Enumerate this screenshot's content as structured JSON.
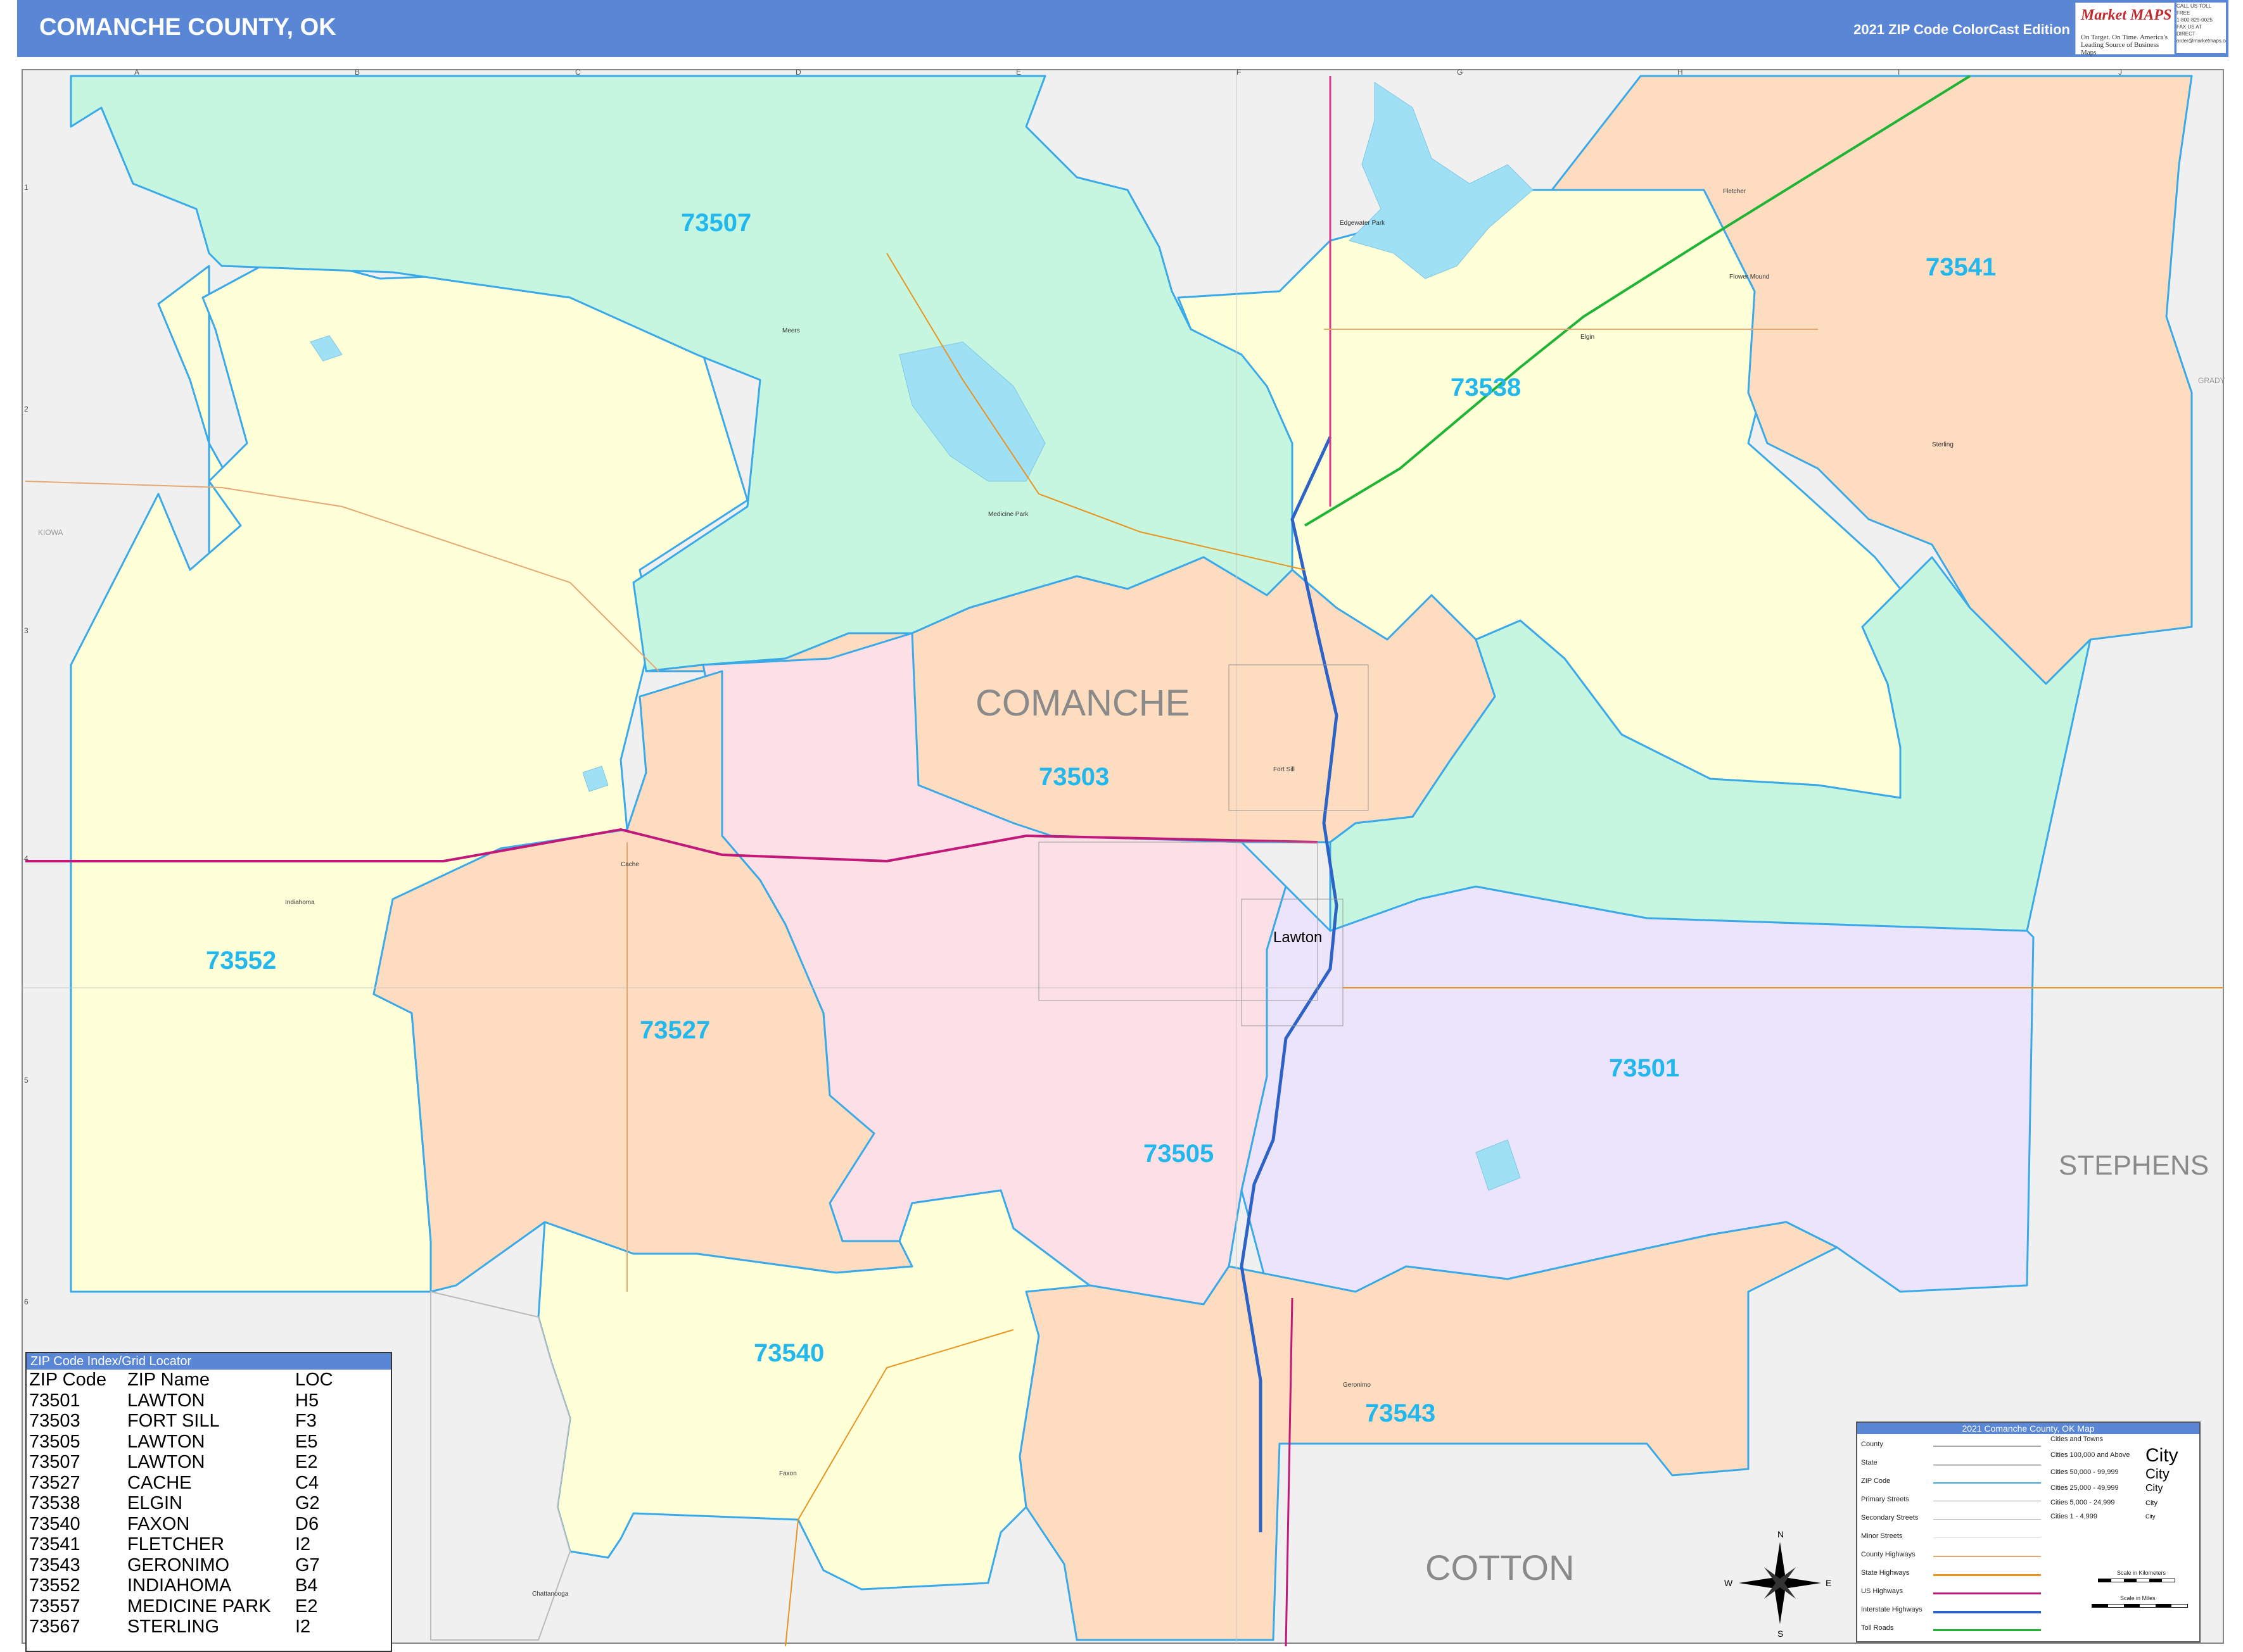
{
  "header": {
    "title": "COMANCHE COUNTY, OK",
    "edition": "2021 ZIP Code ColorCast Edition",
    "logo_text": "Market MAPS",
    "logo_tagline": "On Target. On Time. America's Leading Source of Business Maps",
    "contact_lines": [
      "CALL US TOLL FREE",
      "1-800-829-0025",
      "FAX US AT",
      "DIRECT",
      "order@marketmaps.com"
    ]
  },
  "colors": {
    "header_blue": "#5a86d6",
    "zip_label": "#22b8ee",
    "boundary": "#3aa9e8",
    "green": "#c6f6e0",
    "yellow": "#ffffd8",
    "peach": "#fddcc0",
    "pink": "#fde0e6",
    "lavender": "#ece4fb",
    "gray": "#f0f0f0",
    "water": "#9fe0f5"
  },
  "map": {
    "county_name": "COMANCHE",
    "neighbor_counties": [
      "STEPHENS",
      "COTTON"
    ],
    "small_neighbor_labels": [
      "KIOWA",
      "GRADY"
    ],
    "grid_columns": [
      "A",
      "B",
      "C",
      "D",
      "E",
      "F",
      "G",
      "H",
      "I",
      "J"
    ],
    "grid_rows": [
      "1",
      "2",
      "3",
      "4",
      "5",
      "6"
    ],
    "zip_labels": [
      "73507",
      "73538",
      "73541",
      "73503",
      "73552",
      "73527",
      "73501",
      "73505",
      "73540",
      "73543"
    ],
    "city_label": "Lawton",
    "place_labels": [
      "Edgewater Park",
      "Meers",
      "Medicine Park",
      "Fletcher",
      "Elgin",
      "Sterling",
      "Fort Sill",
      "Cache",
      "Indiahoma",
      "Faxon",
      "Chattanooga",
      "Geronimo",
      "Flower Mound"
    ]
  },
  "zip_index": {
    "title": "ZIP Code Index/Grid Locator",
    "headers": [
      "ZIP Code",
      "ZIP Name",
      "LOC"
    ],
    "rows": [
      [
        "73501",
        "LAWTON",
        "H5"
      ],
      [
        "73503",
        "FORT SILL",
        "F3"
      ],
      [
        "73505",
        "LAWTON",
        "E5"
      ],
      [
        "73507",
        "LAWTON",
        "E2"
      ],
      [
        "73527",
        "CACHE",
        "C4"
      ],
      [
        "73538",
        "ELGIN",
        "G2"
      ],
      [
        "73540",
        "FAXON",
        "D6"
      ],
      [
        "73541",
        "FLETCHER",
        "I2"
      ],
      [
        "73543",
        "GERONIMO",
        "G7"
      ],
      [
        "73552",
        "INDIAHOMA",
        "B4"
      ],
      [
        "73557",
        "MEDICINE PARK",
        "E2"
      ],
      [
        "73567",
        "STERLING",
        "I2"
      ]
    ]
  },
  "legend": {
    "title": "2021 Comanche County, OK Map",
    "items": [
      "County",
      "State",
      "ZIP Code",
      "Primary Streets",
      "Secondary Streets",
      "Minor Streets",
      "County Highways",
      "State Highways",
      "US Highways",
      "Interstate Highways",
      "Toll Roads"
    ],
    "cities_header": "Cities and Towns",
    "city_sizes": [
      "Cities 100,000 and Above",
      "Cities 50,000 - 99,999",
      "Cities 25,000 - 49,999",
      "Cities 5,000 - 24,999",
      "Cities 1 - 4,999"
    ],
    "city_sample": "City",
    "scale_km": "Scale in Kilometers",
    "scale_mi": "Scale in Miles"
  },
  "compass": {
    "n": "N",
    "s": "S",
    "e": "E",
    "w": "W"
  }
}
